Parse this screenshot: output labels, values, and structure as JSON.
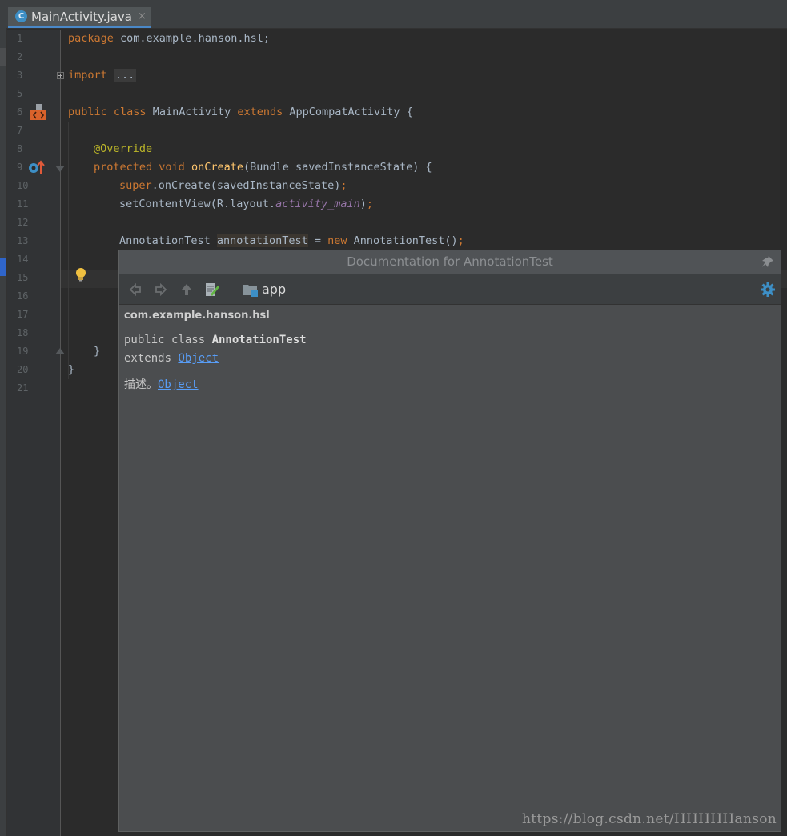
{
  "tab": {
    "icon": "class-c-icon",
    "letter": "C",
    "filename": "MainActivity.java",
    "close": "×"
  },
  "line_numbers": [
    "1",
    "2",
    "3",
    "5",
    "6",
    "7",
    "8",
    "9",
    "10",
    "11",
    "12",
    "13",
    "14",
    "15",
    "16",
    "17",
    "18",
    "19",
    "20",
    "21"
  ],
  "code": {
    "l1_kw": "package",
    "l1_rest": " com.example.hanson.hsl;",
    "l3_kw": "import",
    "l3_dots": "...",
    "l6_kw1": "public",
    "l6_kw2": "class",
    "l6_name": " MainActivity ",
    "l6_kw3": "extends",
    "l6_rest": " AppCompatActivity {",
    "l8_ann": "@Override",
    "l9_kw1": "protected",
    "l9_kw2": "void",
    "l9_meth": "onCreate",
    "l9_rest": "(Bundle savedInstanceState) {",
    "l10_kw": "super",
    "l10_rest": ".onCreate(savedInstanceState)",
    "l10_semi": ";",
    "l11_pre": "setContentView(R.layout.",
    "l11_fld": "activity_main",
    "l11_post": ")",
    "l11_semi": ";",
    "l13_type": "AnnotationTest ",
    "l13_var": "annotationTest",
    "l13_eq": " = ",
    "l13_kw": "new",
    "l13_rest": " AnnotationTest()",
    "l13_semi": ";",
    "l19_brace": "}",
    "l20_brace": "}"
  },
  "doc": {
    "title": "Documentation for AnnotationTest",
    "toolbar_module": "app",
    "package": "com.example.hanson.hsl",
    "sig_prefix": "public class ",
    "sig_class": "AnnotationTest",
    "extends_label": "extends ",
    "extends_link": "Object",
    "desc_text": "描述。",
    "desc_link": "Object"
  },
  "watermark": "https://blog.csdn.net/HHHHHanson",
  "colors": {
    "keyword": "#cc7832",
    "annotation": "#bbb529",
    "method": "#ffc66d",
    "field": "#9876aa",
    "link": "#589df6"
  }
}
